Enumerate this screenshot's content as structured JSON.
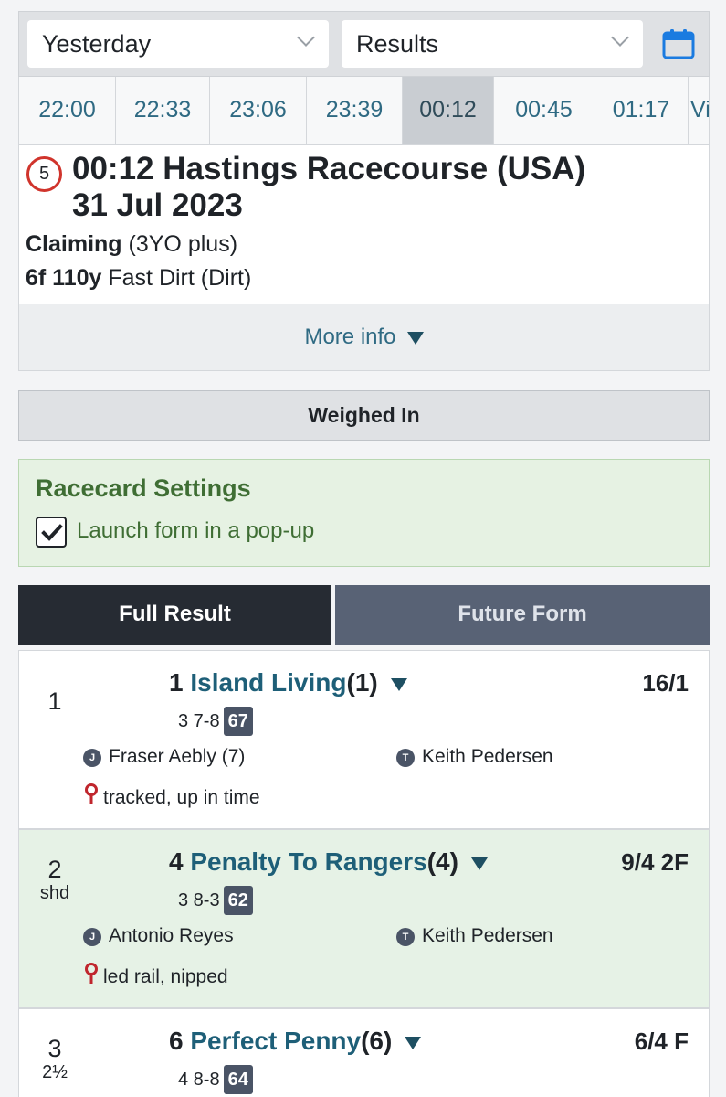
{
  "filters": {
    "day": "Yesterday",
    "view": "Results"
  },
  "icons": {
    "calendar": "calendar-icon",
    "dropdown": "chevron-down-icon"
  },
  "time_tabs": [
    "22:00",
    "22:33",
    "23:06",
    "23:39",
    "00:12",
    "00:45",
    "01:17",
    "Vi"
  ],
  "active_time": "00:12",
  "race": {
    "number": "5",
    "title_line1": "00:12 Hastings Racecourse (USA)",
    "title_line2": "31 Jul 2023",
    "race_type": "Claiming",
    "age_restriction": "(3YO plus)",
    "distance": "6f 110y",
    "surface": "Fast Dirt (Dirt)"
  },
  "more_info_label": "More info",
  "status": "Weighed In",
  "settings": {
    "title": "Racecard Settings",
    "launch_popup_label": "Launch form in a pop-up",
    "launch_popup_checked": true
  },
  "tabs": {
    "full_result": "Full Result",
    "future_form": "Future Form"
  },
  "colors": {
    "accent_blue": "#2f6a83",
    "race_badge_red": "#d0342c",
    "settings_green": "#3f6e34",
    "active_tab": "#262b33"
  },
  "results": [
    {
      "position": "1",
      "distance": "",
      "saddle": "1",
      "horse": "Island Living",
      "draw": "(1)",
      "odds": "16/1",
      "age_weight": "3 7-8",
      "rating": "67",
      "jockey_badge": "J",
      "jockey": "Fraser Aebly (7)",
      "trainer_badge": "T",
      "trainer": "Keith Pedersen",
      "comment": "tracked, up in time"
    },
    {
      "position": "2",
      "distance": "shd",
      "saddle": "4",
      "horse": "Penalty To Rangers",
      "draw": "(4)",
      "odds": "9/4 2F",
      "age_weight": "3 8-3",
      "rating": "62",
      "jockey_badge": "J",
      "jockey": "Antonio Reyes",
      "trainer_badge": "T",
      "trainer": "Keith Pedersen",
      "comment": "led rail, nipped"
    },
    {
      "position": "3",
      "distance": "2½",
      "saddle": "6",
      "horse": "Perfect Penny",
      "draw": "(6)",
      "odds": "6/4 F",
      "age_weight": "4 8-8",
      "rating": "64"
    }
  ]
}
